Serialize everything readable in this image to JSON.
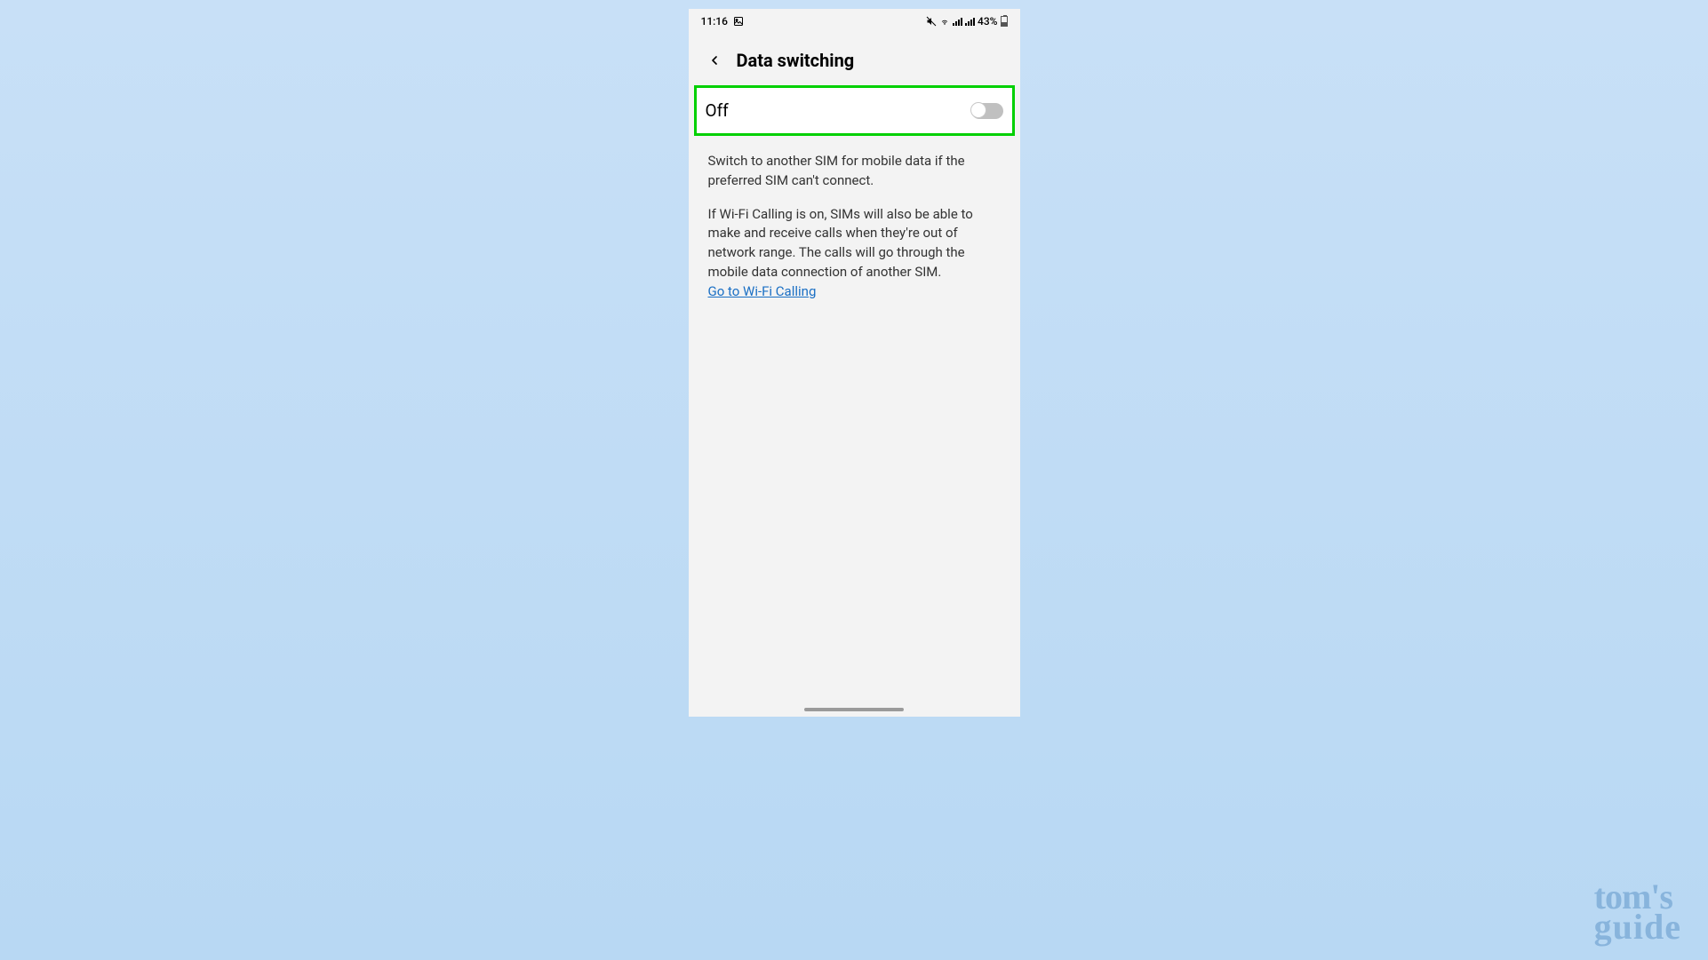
{
  "status_bar": {
    "time": "11:16",
    "battery_percent": "43%",
    "icons": {
      "image": "image-icon",
      "mute": "mute-icon",
      "wifi_small": "wifi-indicator",
      "signal1": "signal-bars",
      "signal2": "signal-bars",
      "battery": "battery-icon"
    }
  },
  "header": {
    "title": "Data switching"
  },
  "toggle": {
    "label": "Off",
    "state": false
  },
  "description": {
    "p1": "Switch to another SIM for mobile data if the preferred SIM can't connect.",
    "p2": "If Wi-Fi Calling is on, SIMs will also be able to make and receive calls when they're out of network range. The calls will go through the mobile data connection of another SIM.",
    "link_text": "Go to Wi-Fi Calling"
  },
  "watermark": {
    "line1": "tom's",
    "line2": "guide"
  }
}
